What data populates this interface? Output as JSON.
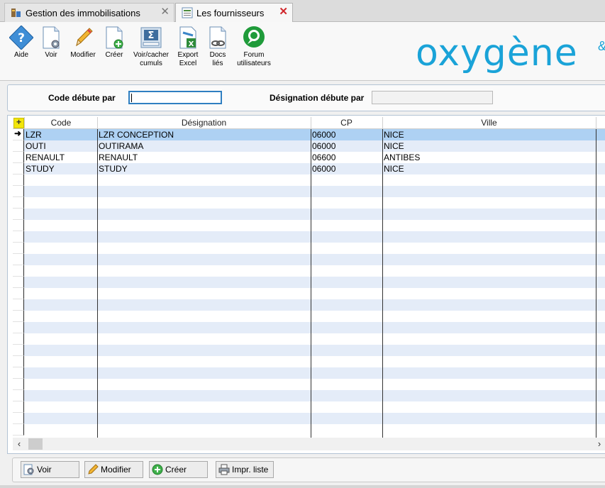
{
  "tabs": [
    {
      "label": "Gestion des immobilisations",
      "icon": "assets-icon",
      "active": false
    },
    {
      "label": "Les fournisseurs",
      "icon": "list-icon",
      "active": true
    }
  ],
  "toolbar": {
    "aide": "Aide",
    "voir": "Voir",
    "modifier": "Modifier",
    "creer": "Créer",
    "cumuls_1": "Voir/cacher",
    "cumuls_2": "cumuls",
    "export_1": "Export",
    "export_2": "Excel",
    "docs_1": "Docs",
    "docs_2": "liés",
    "forum_1": "Forum",
    "forum_2": "utilisateurs"
  },
  "brand": {
    "logo": "oxygène",
    "mark": "&",
    "color": "#1aa3d8"
  },
  "filter": {
    "code_label": "Code débute par",
    "code_value": "",
    "designation_label": "Désignation débute par",
    "designation_value": ""
  },
  "grid": {
    "columns": [
      "Code",
      "Désignation",
      "CP",
      "Ville"
    ],
    "rows": [
      {
        "code": "LZR",
        "designation": "LZR CONCEPTION",
        "cp": "06000",
        "ville": "NICE",
        "selected": true
      },
      {
        "code": "OUTI",
        "designation": "OUTIRAMA",
        "cp": "06000",
        "ville": "NICE",
        "selected": false
      },
      {
        "code": "RENAULT",
        "designation": "RENAULT",
        "cp": "06600",
        "ville": "ANTIBES",
        "selected": false
      },
      {
        "code": "STUDY",
        "designation": "STUDY",
        "cp": "06000",
        "ville": "NICE",
        "selected": false
      }
    ],
    "selected_row_color": "#aed1f3",
    "alt_row_color": "#e4ecf8"
  },
  "bottom_buttons": {
    "voir": "Voir",
    "modifier": "Modifier",
    "creer": "Créer",
    "imprimer": "Impr. liste"
  }
}
